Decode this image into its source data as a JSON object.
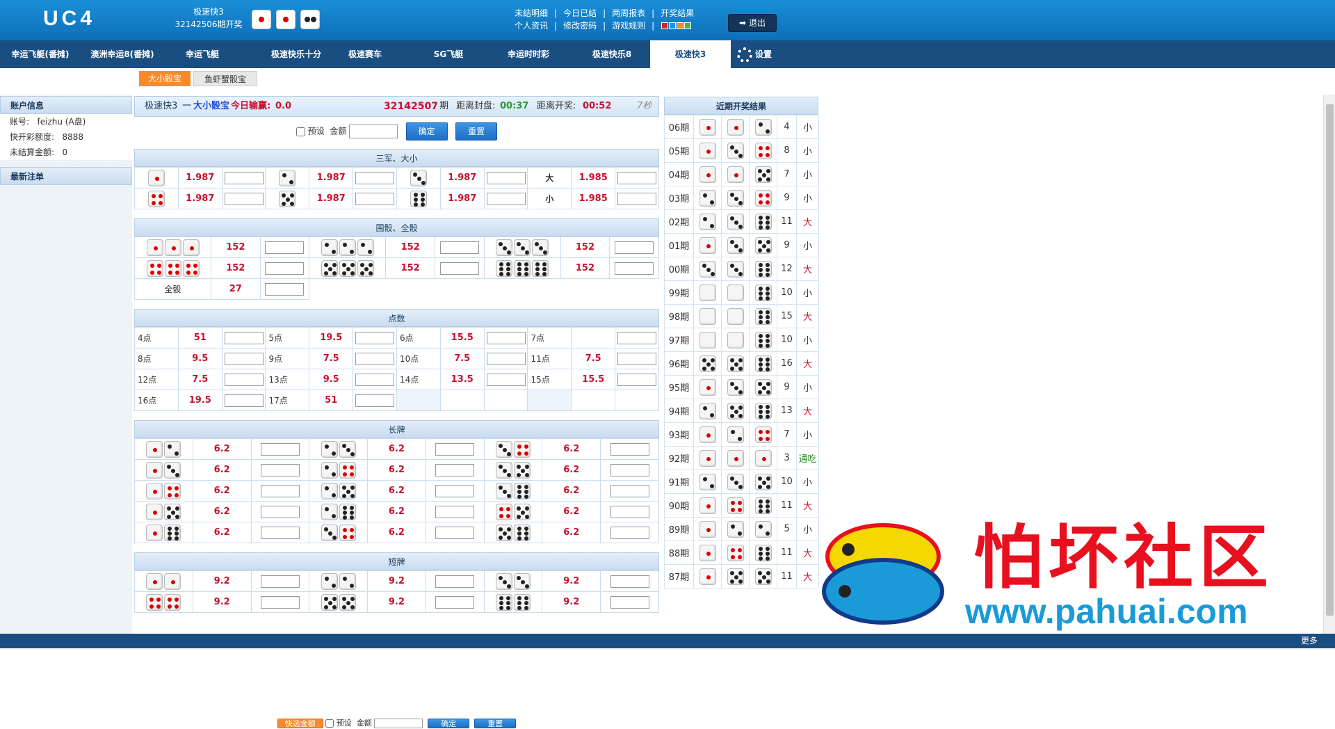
{
  "header": {
    "logo": "UC4",
    "lottery": "极速快3",
    "issue_open": "32142506期开奖",
    "links": [
      "未结明细",
      "今日已结",
      "两周报表",
      "开奖结果",
      "个人资讯",
      "修改密码",
      "游戏规则"
    ],
    "logout": "退出",
    "theme_colors": [
      "#e31b23",
      "#1e90ff",
      "#f08c1e",
      "#4caf50"
    ]
  },
  "nav": {
    "items": [
      "幸运飞艇(番摊)",
      "澳洲幸运8(番摊)",
      "幸运飞艇",
      "极速快乐十分",
      "极速赛车",
      "SG飞艇",
      "幸运时时彩",
      "极速快乐8",
      "极速快3"
    ],
    "settings": "设置"
  },
  "subtabs": [
    "大小骰宝",
    "鱼虾蟹骰宝"
  ],
  "account": {
    "title": "账户信息",
    "account_label": "账号:",
    "account": "feizhu (A盘)",
    "credit_label": "快开彩额度:",
    "credit": "8888",
    "unsettled_label": "未结算金额:",
    "unsettled": "0",
    "recent_title": "最新注单"
  },
  "infobar": {
    "lottery": "极速快3",
    "dash": "一",
    "game": "大小骰宝",
    "win_label": "今日输赢:",
    "win": "0.0",
    "issue": "32142507",
    "issue_suffix": "期",
    "close_label": "距离封盘:",
    "close": "00:37",
    "open_label": "距离开奖:",
    "open": "00:52",
    "refresh": "7秒"
  },
  "form": {
    "preset": "预设",
    "amount": "金额",
    "confirm": "确定",
    "reset": "重置",
    "quick": "快选金额"
  },
  "sanjun": {
    "title": "三军、大小",
    "rows": [
      [
        "1",
        "1.987",
        "2",
        "1.987",
        "3",
        "1.987"
      ],
      [
        "4",
        "1.987",
        "5",
        "1.987",
        "6",
        "1.987"
      ]
    ],
    "daxiao": [
      [
        "大",
        "1.985"
      ],
      [
        "小",
        "1.985"
      ]
    ]
  },
  "weishai": {
    "title": "围骰、全骰",
    "rows": [
      [
        "111",
        "152",
        "222",
        "152",
        "333",
        "152"
      ],
      [
        "444",
        "152",
        "555",
        "152",
        "666",
        "152"
      ]
    ],
    "quan_label": "全骰",
    "quan": "27"
  },
  "dianshu": {
    "title": "点数",
    "rows": [
      [
        "4点",
        "51",
        "5点",
        "19.5",
        "6点",
        "15.5",
        "7点",
        ""
      ],
      [
        "8点",
        "9.5",
        "9点",
        "7.5",
        "10点",
        "7.5",
        "11点",
        "7.5"
      ],
      [
        "12点",
        "7.5",
        "13点",
        "9.5",
        "14点",
        "13.5",
        "15点",
        "15.5"
      ],
      [
        "16点",
        "19.5",
        "17点",
        "51",
        "",
        "",
        "",
        ""
      ]
    ]
  },
  "changpai": {
    "title": "长牌",
    "rows": [
      [
        "12",
        "6.2",
        "23",
        "6.2",
        "34",
        "6.2"
      ],
      [
        "13",
        "6.2",
        "24",
        "6.2",
        "35",
        "6.2"
      ],
      [
        "14",
        "6.2",
        "25",
        "6.2",
        "36",
        "6.2"
      ],
      [
        "15",
        "6.2",
        "26",
        "6.2",
        "45",
        "6.2"
      ],
      [
        "16",
        "6.2",
        "34",
        "6.2",
        "56",
        "6.2"
      ]
    ]
  },
  "duanpai": {
    "title": "短牌",
    "rows": [
      [
        "11",
        "9.2",
        "22",
        "9.2",
        "33",
        "9.2"
      ],
      [
        "44",
        "9.2",
        "55",
        "9.2",
        "66",
        "9.2"
      ]
    ]
  },
  "results": {
    "title": "近期开奖结果",
    "rows": [
      [
        "06期",
        "1",
        "1",
        "2",
        "4",
        "小"
      ],
      [
        "05期",
        "1",
        "3",
        "4",
        "8",
        "小"
      ],
      [
        "04期",
        "1",
        "1",
        "5",
        "7",
        "小"
      ],
      [
        "03期",
        "2",
        "3",
        "4",
        "9",
        "小"
      ],
      [
        "02期",
        "2",
        "3",
        "6",
        "11",
        "大"
      ],
      [
        "01期",
        "1",
        "3",
        "5",
        "9",
        "小"
      ],
      [
        "00期",
        "3",
        "3",
        "6",
        "12",
        "大"
      ],
      [
        "99期",
        "",
        "",
        "6",
        "10",
        "小"
      ],
      [
        "98期",
        "",
        "",
        "6",
        "15",
        "大"
      ],
      [
        "97期",
        "",
        "",
        "6",
        "10",
        "小"
      ],
      [
        "96期",
        "5",
        "5",
        "6",
        "16",
        "大"
      ],
      [
        "95期",
        "1",
        "3",
        "5",
        "9",
        "小"
      ],
      [
        "94期",
        "2",
        "5",
        "6",
        "13",
        "大"
      ],
      [
        "93期",
        "1",
        "2",
        "4",
        "7",
        "小"
      ],
      [
        "92期",
        "1",
        "1",
        "1",
        "3",
        "通吃"
      ],
      [
        "91期",
        "2",
        "3",
        "5",
        "10",
        "小"
      ],
      [
        "90期",
        "1",
        "4",
        "6",
        "11",
        "大"
      ],
      [
        "89期",
        "1",
        "2",
        "2",
        "5",
        "小"
      ],
      [
        "88期",
        "1",
        "4",
        "6",
        "11",
        "大"
      ],
      [
        "87期",
        "1",
        "5",
        "5",
        "11",
        "大"
      ]
    ]
  },
  "watermark": {
    "text": "怕坏社区",
    "url": "www.pahuai.com"
  },
  "footer": {
    "more": "更多"
  }
}
